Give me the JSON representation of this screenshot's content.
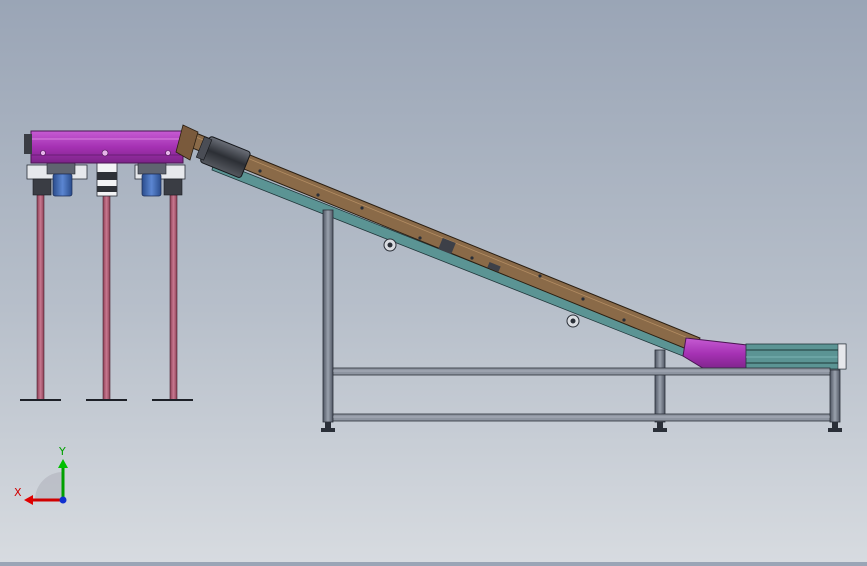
{
  "viewport": {
    "background_top": "#9aa5b6",
    "background_bottom": "#d7dbe0"
  },
  "colors": {
    "magenta": "#b13ac0",
    "magenta_dark": "#6e1f78",
    "frame_steel": "#6f7684",
    "frame_edge": "#2a2f38",
    "pink_leg": "#b25a74",
    "belt_brown": "#7a5a3c",
    "belt_teal": "#4f8a8a",
    "motor_blue": "#3b63b0",
    "motor_dark": "#3a3d44",
    "axis_x": "#d00000",
    "axis_y": "#00a000",
    "axis_z": "#1030d0"
  },
  "icons": [
    "xyz-triad-icon"
  ],
  "triad": {
    "x_label": "X",
    "y_label": "Y"
  }
}
